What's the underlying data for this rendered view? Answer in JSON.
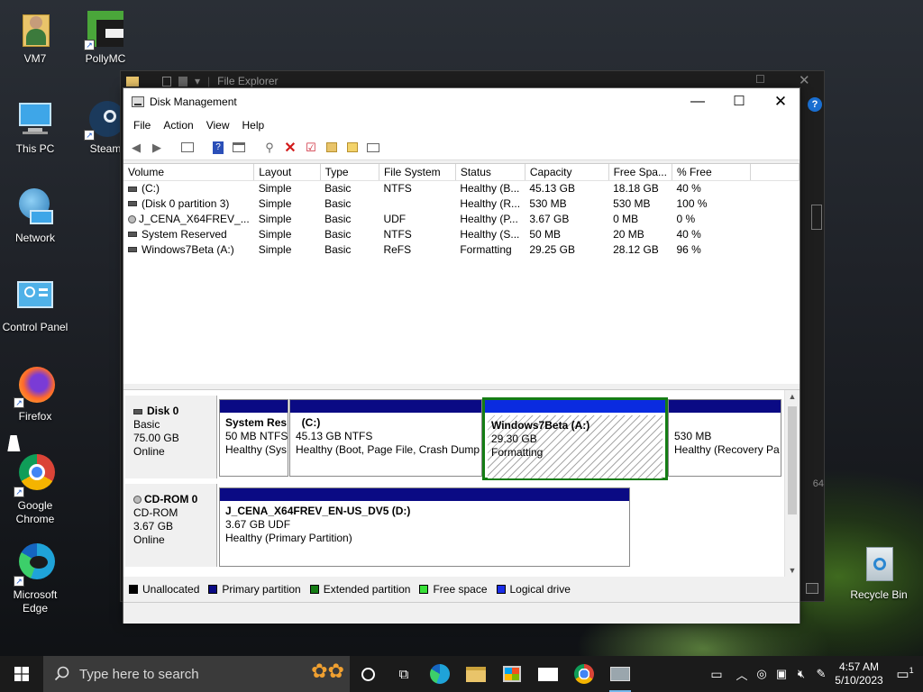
{
  "desktop": {
    "icons": [
      {
        "label": "VM7"
      },
      {
        "label": "PollyMC"
      },
      {
        "label": "This PC"
      },
      {
        "label": "Steam"
      },
      {
        "label": "Network"
      },
      {
        "label": "Control Panel"
      },
      {
        "label": "Firefox"
      },
      {
        "label": "Google Chrome"
      },
      {
        "label": "Microsoft Edge"
      },
      {
        "label": "Recycle Bin"
      }
    ]
  },
  "explorer": {
    "title": "File Explorer",
    "side_number": "64",
    "help_glyph": "?"
  },
  "window": {
    "title": "Disk Management",
    "menu": [
      "File",
      "Action",
      "View",
      "Help"
    ],
    "columns": [
      "Volume",
      "Layout",
      "Type",
      "File System",
      "Status",
      "Capacity",
      "Free Spa...",
      "% Free"
    ],
    "volumes": [
      {
        "volume": "(C:)",
        "layout": "Simple",
        "type": "Basic",
        "fs": "NTFS",
        "status": "Healthy (B...",
        "capacity": "45.13 GB",
        "free": "18.18 GB",
        "pct": "40 %",
        "icon": "drive"
      },
      {
        "volume": "(Disk 0 partition 3)",
        "layout": "Simple",
        "type": "Basic",
        "fs": "",
        "status": "Healthy (R...",
        "capacity": "530 MB",
        "free": "530 MB",
        "pct": "100 %",
        "icon": "drive"
      },
      {
        "volume": "J_CENA_X64FREV_...",
        "layout": "Simple",
        "type": "Basic",
        "fs": "UDF",
        "status": "Healthy (P...",
        "capacity": "3.67 GB",
        "free": "0 MB",
        "pct": "0 %",
        "icon": "cd"
      },
      {
        "volume": "System Reserved",
        "layout": "Simple",
        "type": "Basic",
        "fs": "NTFS",
        "status": "Healthy (S...",
        "capacity": "50 MB",
        "free": "20 MB",
        "pct": "40 %",
        "icon": "drive"
      },
      {
        "volume": "Windows7Beta (A:)",
        "layout": "Simple",
        "type": "Basic",
        "fs": "ReFS",
        "status": "Formatting",
        "capacity": "29.25 GB",
        "free": "28.12 GB",
        "pct": "96 %",
        "icon": "drive"
      }
    ],
    "disk0": {
      "name": "Disk 0",
      "type": "Basic",
      "size": "75.00 GB",
      "state": "Online",
      "partitions": [
        {
          "name": "System Res",
          "size": "50 MB NTFS",
          "status": "Healthy (Sys"
        },
        {
          "name": "(C:)",
          "size": "45.13 GB NTFS",
          "status": "Healthy (Boot, Page File, Crash Dump"
        },
        {
          "name": "Windows7Beta  (A:)",
          "size": "29.30 GB",
          "status": "Formatting"
        },
        {
          "name": "",
          "size": "530 MB",
          "status": "Healthy (Recovery Pa"
        }
      ]
    },
    "cdrom0": {
      "name": "CD-ROM 0",
      "type": "CD-ROM",
      "size": "3.67 GB",
      "state": "Online",
      "partition": {
        "name": "J_CENA_X64FREV_EN-US_DV5  (D:)",
        "size": "3.67 GB UDF",
        "status": "Healthy (Primary Partition)"
      }
    },
    "legend": [
      {
        "label": "Unallocated",
        "color": "#000000"
      },
      {
        "label": "Primary partition",
        "color": "#0a0a84"
      },
      {
        "label": "Extended partition",
        "color": "#157d15"
      },
      {
        "label": "Free space",
        "color": "#38e038"
      },
      {
        "label": "Logical drive",
        "color": "#1a2ee8"
      }
    ]
  },
  "taskbar": {
    "search_placeholder": "Type here to search",
    "time": "4:57 AM",
    "date": "5/10/2023",
    "notification_count": "1"
  }
}
